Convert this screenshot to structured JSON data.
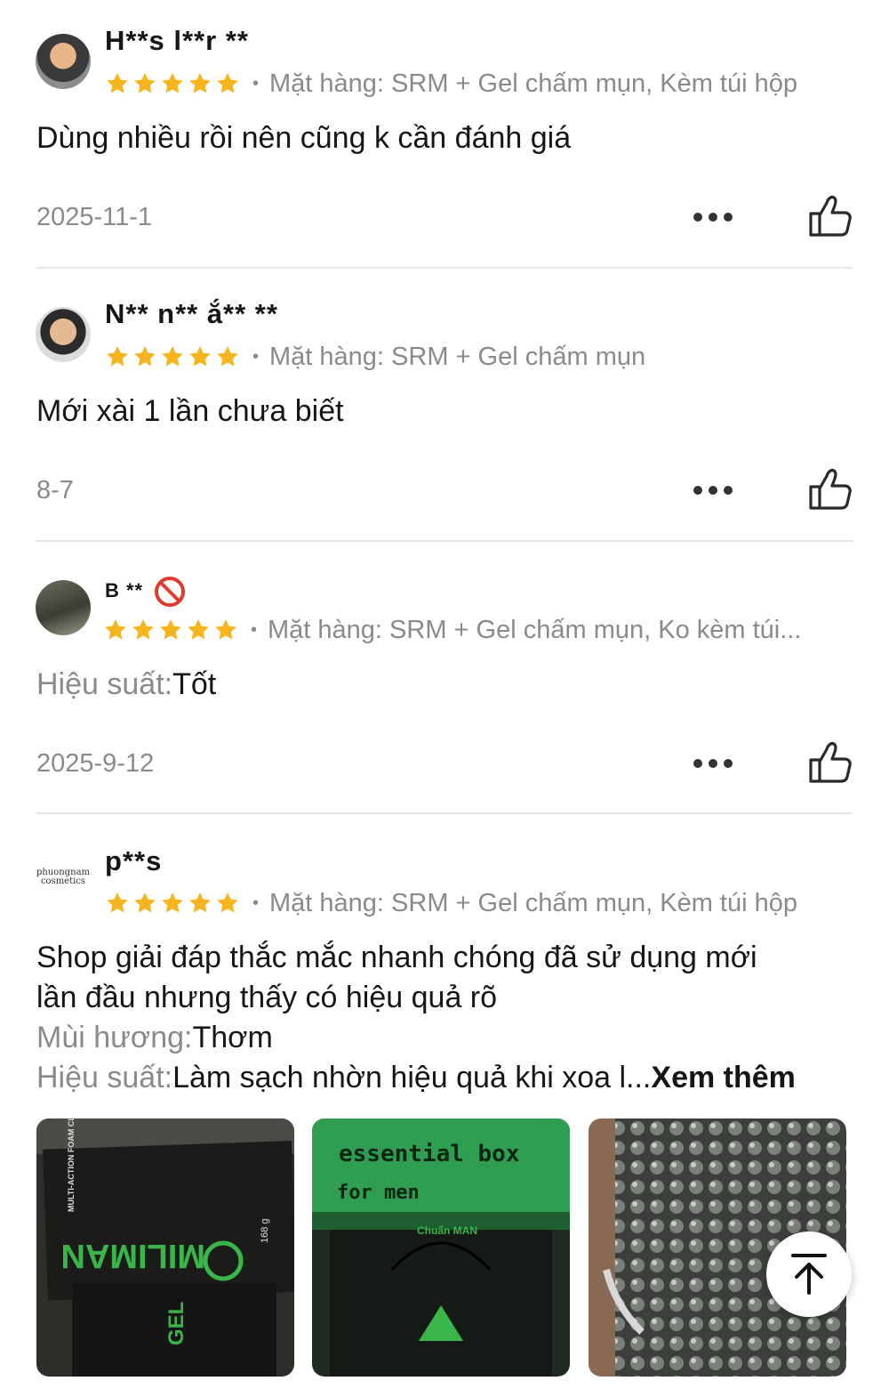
{
  "reviews": [
    {
      "username": "H**s l**r **",
      "rating": 5,
      "variant": "Mặt hàng: SRM + Gel chấm mụn, Kèm túi hộp",
      "comment": "Dùng nhiều rồi nên cũng k cần đánh giá",
      "date": "2025-11-1"
    },
    {
      "username": "N** n** ắ** **",
      "rating": 5,
      "variant": "Mặt hàng: SRM + Gel chấm mụn",
      "comment": "Mới xài 1 lần chưa biết",
      "date": "8-7"
    },
    {
      "username": "B **",
      "rating": 5,
      "variant": "Mặt hàng: SRM + Gel chấm mụn, Ko kèm túi...",
      "attr_label": "Hiệu suất:",
      "attr_value": "Tốt",
      "date": "2025-9-12"
    },
    {
      "username": "p**s",
      "avatar_text": "phuongnam cosmetics",
      "rating": 5,
      "variant": "Mặt hàng: SRM + Gel chấm mụn, Kèm túi hộp",
      "comment_line1": "Shop giải đáp thắc mắc nhanh chóng đã sử dụng mới",
      "comment_line2": "lần đầu nhưng thấy có hiệu quả rõ",
      "attr1_label": "Mùi hương:",
      "attr1_value": "Thơm",
      "attr2_label": "Hiệu suất:",
      "attr2_value": "Làm sạch nhờn hiệu quả khi xoa l...",
      "see_more": "Xem thêm",
      "photos": [
        {
          "box_text": "MILIMAN",
          "sub_text": "MULTI-ACTION FOAM CLEANSER",
          "gel_text": "GEL",
          "weight": "168 g"
        },
        {
          "line1": "essential box",
          "line2": "for men",
          "bag_text": "Chuẩn MAN"
        },
        {}
      ]
    }
  ],
  "colors": {
    "star": "#f6b51e",
    "gray_text": "#8a8a8a",
    "divider": "#e6e6e6"
  },
  "icons": {
    "like": "thumbs-up-icon",
    "more": "more-dots-icon",
    "scroll_top": "arrow-up-to-top-icon",
    "ban": "no-entry-icon"
  }
}
